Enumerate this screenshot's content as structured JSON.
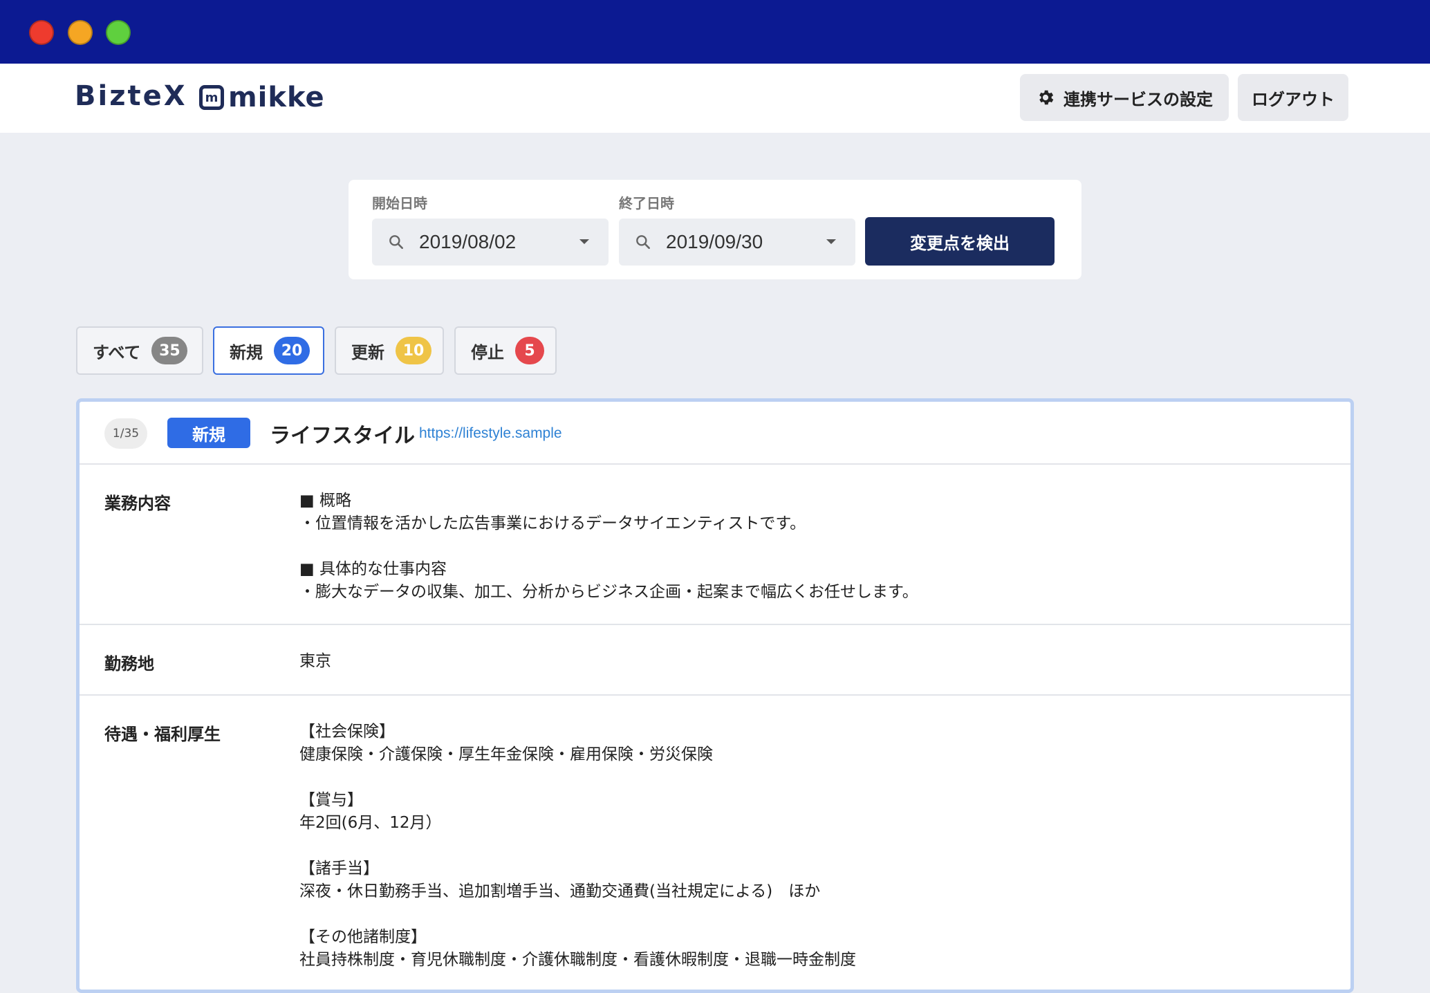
{
  "header": {
    "brand_biztex": "BizteX",
    "brand_mikke_mark": "m",
    "brand_mikke": "mikke",
    "settings_label": "連携サービスの設定",
    "logout_label": "ログアウト"
  },
  "search": {
    "start_label": "開始日時",
    "start_value": "2019/08/02",
    "end_label": "終了日時",
    "end_value": "2019/09/30",
    "detect_label": "変更点を検出"
  },
  "tabs": [
    {
      "label": "すべて",
      "count": "35"
    },
    {
      "label": "新規",
      "count": "20"
    },
    {
      "label": "更新",
      "count": "10"
    },
    {
      "label": "停止",
      "count": "5"
    }
  ],
  "detail": {
    "position": "1/35",
    "status_tag": "新規",
    "title": "ライフスタイル",
    "url": "https://lifestyle.sample",
    "rows": [
      {
        "label": "業務内容",
        "lines": [
          "■ 概略",
          "・位置情報を活かした広告事業におけるデータサイエンティストです。",
          "",
          "■ 具体的な仕事内容",
          "・膨大なデータの収集、加工、分析からビジネス企画・起案まで幅広くお任せします。"
        ]
      },
      {
        "label": "勤務地",
        "lines": [
          "東京"
        ]
      },
      {
        "label": "待遇・福利厚生",
        "lines": [
          "【社会保険】",
          "健康保険・介護保険・厚生年金保険・雇用保険・労災保険",
          "",
          "【賞与】",
          "年2回(6月、12月）",
          "",
          "【諸手当】",
          "深夜・休日勤務手当、追加割増手当、通勤交通費(当社規定による)　ほか",
          "",
          "【その他諸制度】",
          "社員持株制度・育児休職制度・介護休職制度・看護休暇制度・退職一時金制度"
        ]
      }
    ]
  },
  "colors": {
    "titlebar": "#0c1a92",
    "brand_navy": "#1b2c5f",
    "new_blue": "#2f6ce5",
    "update_yellow": "#efc447",
    "stop_red": "#e5484d"
  },
  "icons": [
    "gear-icon",
    "search-icon",
    "caret-down-icon"
  ]
}
